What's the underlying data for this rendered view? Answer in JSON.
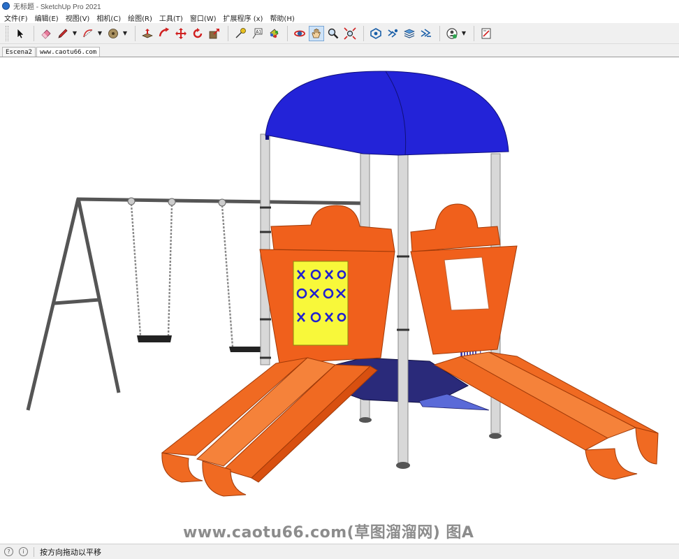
{
  "window": {
    "title": "无标题 - SketchUp Pro 2021"
  },
  "menu": [
    {
      "label": "文件(F)"
    },
    {
      "label": "编辑(E)"
    },
    {
      "label": "视图(V)"
    },
    {
      "label": "相机(C)"
    },
    {
      "label": "绘图(R)"
    },
    {
      "label": "工具(T)"
    },
    {
      "label": "窗口(W)"
    },
    {
      "label": "扩展程序 (x)"
    },
    {
      "label": "帮助(H)"
    }
  ],
  "toolbar": {
    "tools": [
      "select-icon",
      "eraser-icon",
      "pencil-line-icon",
      "arc-icon",
      "shape-circle-icon",
      "push-pull-icon",
      "follow-me-icon",
      "move-icon",
      "rotate-icon",
      "scale-icon",
      "tape-measure-icon",
      "text-icon",
      "paint-bucket-icon",
      "orbit-icon",
      "pan-icon",
      "zoom-icon",
      "zoom-extents-icon",
      "warehouse-icon",
      "extension-warehouse-icon",
      "layout-icon",
      "components-icon",
      "account-icon",
      "report-icon"
    ],
    "active_tool": "pan-icon",
    "text_tool_glyph": "A1"
  },
  "scene_tabs": [
    {
      "label": "Escena2",
      "active": false
    },
    {
      "label": "www.caotu66.com",
      "active": true
    }
  ],
  "viewport": {
    "watermark": "www.caotu66.com(草图溜溜网) 图A",
    "colors": {
      "canopy": "#2323d8",
      "slide": "#f0601c",
      "panel_yellow": "#f8f83a",
      "post": "#d8d8d8",
      "swing_frame": "#555555",
      "deck": "#2a2a7a"
    }
  },
  "status": {
    "message": "按方向拖动以平移",
    "info_glyph": "i"
  }
}
